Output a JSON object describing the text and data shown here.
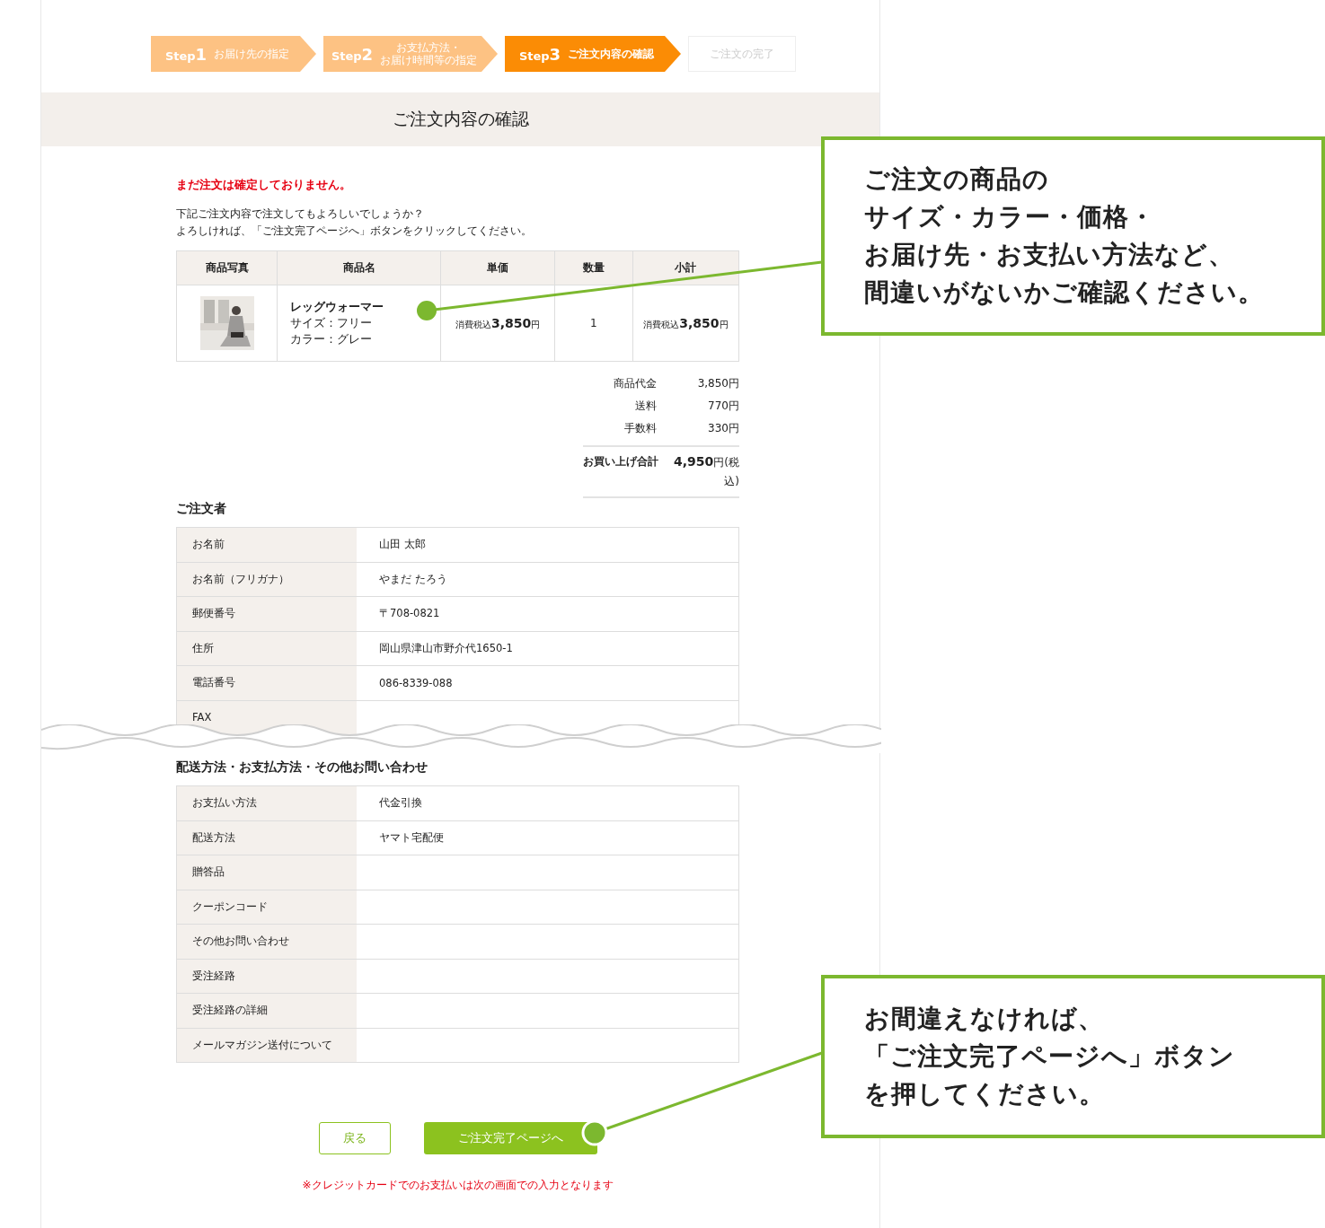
{
  "steps": [
    {
      "step": "Step",
      "number": "1",
      "label_lines": [
        "お届け先の指定"
      ],
      "completed": true,
      "selected": false
    },
    {
      "step": "Step",
      "number": "2",
      "label_lines": [
        "お支払方法・",
        "お届け時間等の指定"
      ],
      "completed": true,
      "selected": false
    },
    {
      "step": "Step",
      "number": "3",
      "label_lines": [
        "ご注文内容の確認"
      ],
      "completed": false,
      "selected": true
    },
    {
      "label_lines": [
        "ご注文の完了"
      ],
      "completed": false,
      "selected": false
    }
  ],
  "page_title": "ご注文内容の確認",
  "warning": "まだ注文は確定しておりません。",
  "intro": [
    "下記ご注文内容で注文してもよろしいでしょうか？",
    "よろしければ、「ご注文完了ページへ」ボタンをクリックしてください。"
  ],
  "order_table": {
    "columns": [
      "商品写真",
      "商品名",
      "単価",
      "数量",
      "小計"
    ],
    "rows": [
      {
        "name": "レッグウォーマー",
        "size_label": "サイズ：フリー",
        "color_label": "カラー：グレー",
        "price": "消費税込**3,850**円",
        "quantity": "1",
        "subtotal": "消費税込**3,850**円"
      }
    ]
  },
  "summary": [
    {
      "label": "商品代金",
      "value": "3,850円"
    },
    {
      "label": "送料",
      "value": "770円"
    },
    {
      "label": "手数料",
      "value": "330円"
    }
  ],
  "total": {
    "label": "お買い上げ合計",
    "value": "**4,950**円(税込)"
  },
  "sections": [
    {
      "title": "ご注文者",
      "cut": true,
      "rows": [
        {
          "label": "お名前",
          "value": "山田 太郎"
        },
        {
          "label": "お名前（フリガナ）",
          "value": "やまだ たろう"
        },
        {
          "label": "郵便番号",
          "value": "〒708-0821"
        },
        {
          "label": "住所",
          "value": "岡山県津山市野介代1650-1"
        },
        {
          "label": "電話番号",
          "value": "086-8339-088"
        },
        {
          "label": "FAX"
        }
      ]
    },
    {
      "title": "配送方法・お支払方法・その他お問い合わせ",
      "cut": false,
      "rows": [
        {
          "label": "お支払い方法",
          "value": "代金引換"
        },
        {
          "label": "配送方法",
          "value": "ヤマト宅配便"
        },
        {
          "label": "贈答品"
        },
        {
          "label": "クーポンコード"
        },
        {
          "label": "その他お問い合わせ"
        },
        {
          "label": "受注経路"
        },
        {
          "label": "受注経路の詳細"
        },
        {
          "label": "メールマガジン送付について"
        }
      ]
    }
  ],
  "buttons": [
    {
      "label": "戻る",
      "kind": "secondary"
    },
    {
      "label": "ご注文完了ページへ",
      "kind": "primary"
    }
  ],
  "note": "※クレジットカードでのお支払いは次の画面での入力となります",
  "callouts": [
    {
      "lines": [
        "ご注文の商品の",
        "サイズ・カラー・価格・",
        "お届け先・お支払い方法など、",
        "間違いがないかご確認ください。"
      ]
    },
    {
      "lines": [
        "お間違えなければ、",
        "「ご注文完了ページへ」ボタン",
        "を押してください。"
      ]
    }
  ]
}
